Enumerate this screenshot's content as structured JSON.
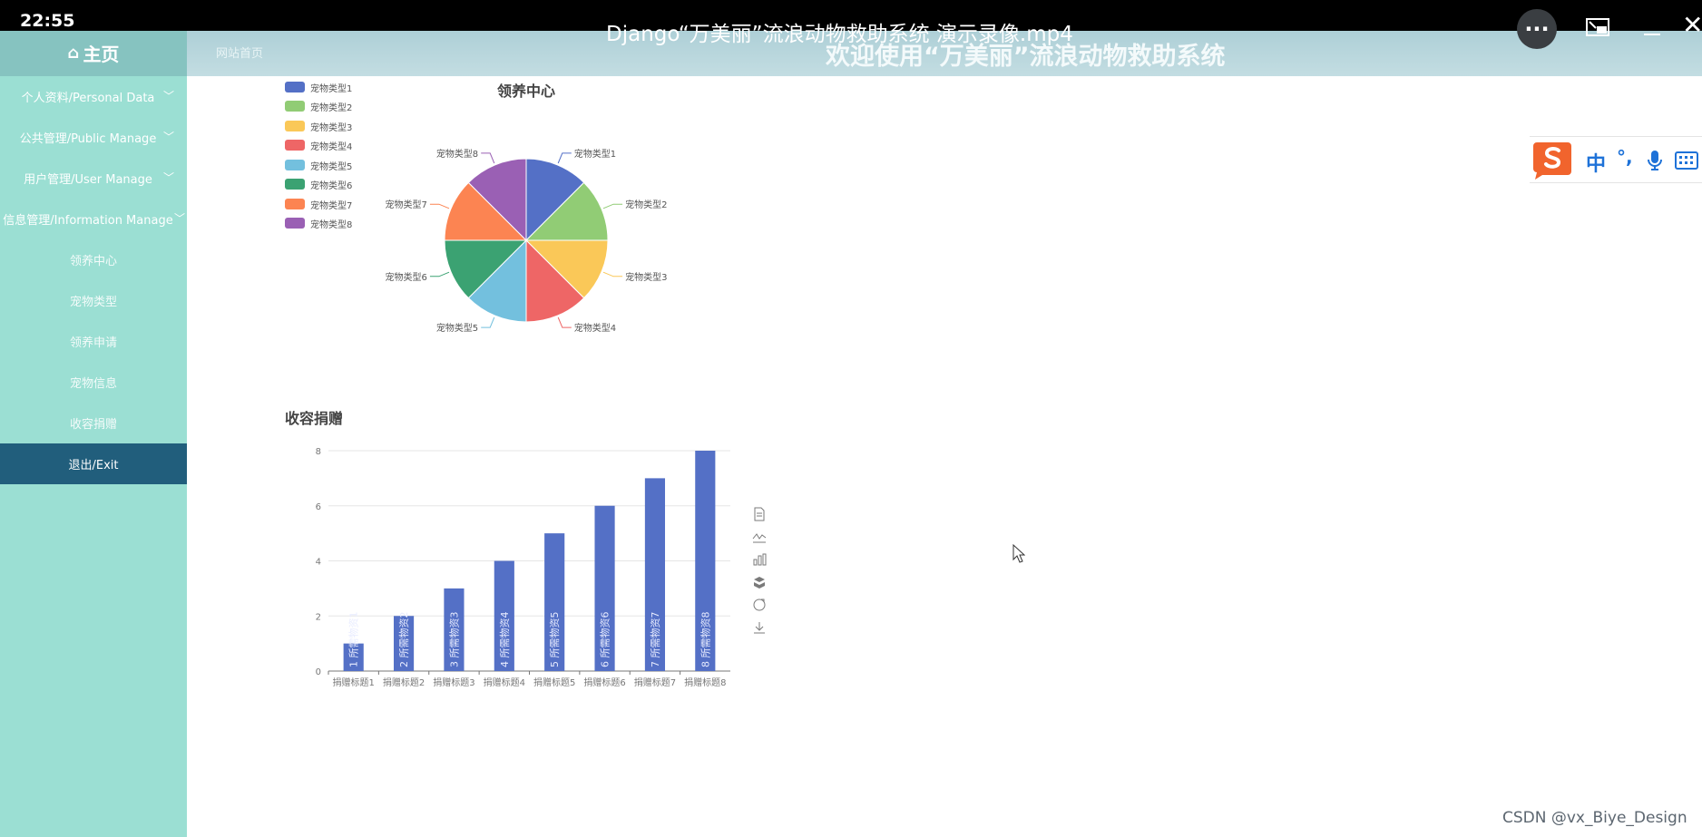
{
  "player": {
    "clock": "22:55",
    "video_title": "Django“万美丽”流浪动物救助系统 演示录像.mp4",
    "more_label": "···"
  },
  "header": {
    "home_label": "主页",
    "site_link": "网站首页",
    "app_title": "欢迎使用“万美丽”流浪动物救助系统"
  },
  "sidebar": {
    "menus": [
      {
        "label": "个人资料/Personal Data"
      },
      {
        "label": "公共管理/Public Manage"
      },
      {
        "label": "用户管理/User Manage"
      },
      {
        "label": "信息管理/Information Manage"
      }
    ],
    "submenu": [
      {
        "label": "领养中心"
      },
      {
        "label": "宠物类型"
      },
      {
        "label": "领养申请"
      },
      {
        "label": "宠物信息"
      },
      {
        "label": "收容捐赠"
      },
      {
        "label": "退出/Exit"
      }
    ]
  },
  "pie_chart": {
    "title": "领养中心",
    "legend": [
      "宠物类型1",
      "宠物类型2",
      "宠物类型3",
      "宠物类型4",
      "宠物类型5",
      "宠物类型6",
      "宠物类型7",
      "宠物类型8"
    ]
  },
  "bar_chart": {
    "title": "收容捐赠",
    "toolbox": [
      "data-view-icon",
      "line-chart-icon",
      "bar-chart-icon",
      "stack-icon",
      "restore-icon",
      "download-icon"
    ]
  },
  "chart_data": [
    {
      "type": "pie",
      "title": "领养中心",
      "categories": [
        "宠物类型1",
        "宠物类型2",
        "宠物类型3",
        "宠物类型4",
        "宠物类型5",
        "宠物类型6",
        "宠物类型7",
        "宠物类型8"
      ],
      "values": [
        1,
        1,
        1,
        1,
        1,
        1,
        1,
        1
      ],
      "colors": [
        "#5470c6",
        "#91cc75",
        "#fac858",
        "#ee6666",
        "#73c0de",
        "#3ba272",
        "#fc8452",
        "#9a60b4"
      ],
      "legend_position": "top-left"
    },
    {
      "type": "bar",
      "title": "收容捐赠",
      "categories": [
        "捐赠标题1",
        "捐赠标题2",
        "捐赠标题3",
        "捐赠标题4",
        "捐赠标题5",
        "捐赠标题6",
        "捐赠标题7",
        "捐赠标题8"
      ],
      "values": [
        1,
        2,
        3,
        4,
        5,
        6,
        7,
        8
      ],
      "bar_labels": [
        "1 所需物资1",
        "2 所需物资2",
        "3 所需物资3",
        "4 所需物资4",
        "5 所需物资5",
        "6 所需物资6",
        "7 所需物资7",
        "8 所需物资8"
      ],
      "yticks": [
        "0",
        "2",
        "4",
        "6",
        "8"
      ],
      "ylim": [
        0,
        8
      ],
      "grid": true,
      "color": "#5470c6"
    }
  ],
  "ime": {
    "mode_label": "中",
    "punct_label": "°,"
  },
  "watermark": "CSDN @vx_Biye_Design"
}
